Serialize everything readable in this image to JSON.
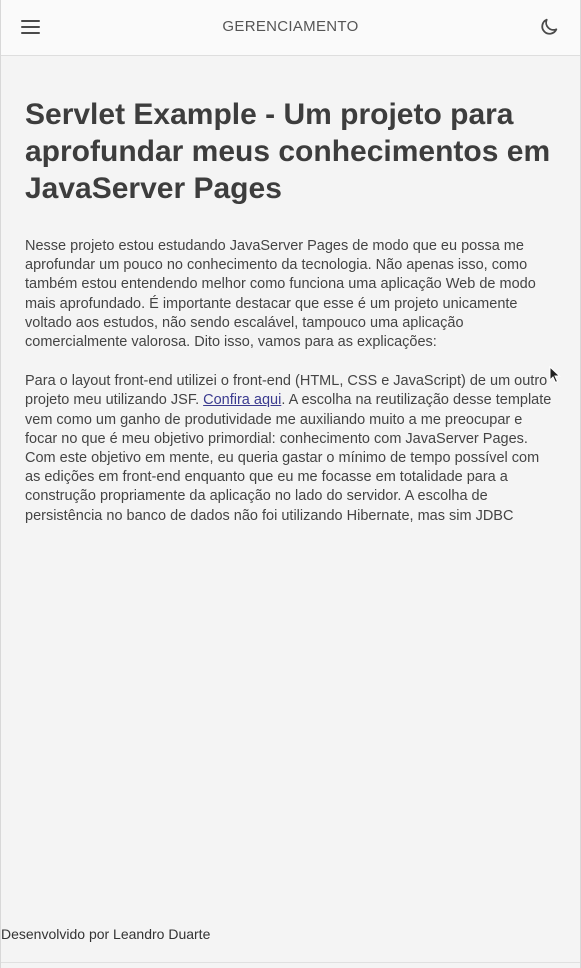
{
  "header": {
    "title": "GERENCIAMENTO",
    "menu_icon": "hamburger-menu-icon",
    "theme_icon": "moon-icon"
  },
  "main": {
    "heading": "Servlet Example - Um projeto para aprofundar meus conhecimentos em JavaServer Pages",
    "paragraph1": "Nesse projeto estou estudando JavaServer Pages de modo que eu possa me aprofundar um pouco no conhecimento da tecnologia. Não apenas isso, como também estou entendendo melhor como funciona uma aplicação Web de modo mais aprofundado. É importante destacar que esse é um projeto unicamente voltado aos estudos, não sendo escalável, tampouco uma aplicação comercialmente valorosa. Dito isso, vamos para as explicações:",
    "paragraph2_before_link": "Para o layout front-end utilizei o front-end (HTML, CSS e JavaScript) de um outro projeto meu utilizando JSF. ",
    "paragraph2_link": "Confira aqui",
    "paragraph2_after_link": ". A escolha na reutilização desse template vem como um ganho de produtividade me auxiliando muito a me preocupar e focar no que é meu objetivo primordial: conhecimento com JavaServer Pages. Com este objetivo em mente, eu queria gastar o mínimo de tempo possível com as edições em front-end enquanto que eu me focasse em totalidade para a construção propriamente da aplicação no lado do servidor. A escolha de persistência no banco de dados não foi utilizando Hibernate, mas sim JDBC"
  },
  "footer": {
    "credit": "Desenvolvido por Leandro Duarte"
  },
  "colors": {
    "background": "#f4f4f4",
    "topbar": "#fafafa",
    "text": "#444444",
    "link": "#3b3b8f"
  }
}
